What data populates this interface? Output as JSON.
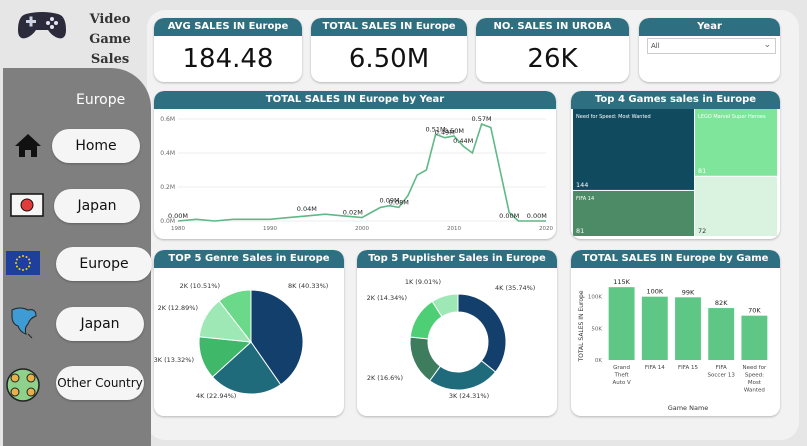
{
  "app": {
    "title_line1": "Video Game",
    "title_line2": "Sales"
  },
  "sidebar": {
    "region_title": "Europe",
    "nav": [
      {
        "label": "Home",
        "icon": "home-icon"
      },
      {
        "label": "Japan",
        "icon": "japan-flag-icon"
      },
      {
        "label": "Europe",
        "icon": "eu-flag-icon"
      },
      {
        "label": "Japan",
        "icon": "north-america-map-icon"
      },
      {
        "label": "Other Country",
        "icon": "globe-icon"
      }
    ]
  },
  "kpis": [
    {
      "title": "AVG SALES IN Europe",
      "value": "184.48"
    },
    {
      "title": "TOTAL SALES IN Europe",
      "value": "6.50M"
    },
    {
      "title": "NO. SALES IN UROBA",
      "value": "26K"
    }
  ],
  "year_filter": {
    "title": "Year",
    "selected": "All"
  },
  "line_chart": {
    "title": "TOTAL SALES IN Europe by Year",
    "y_ticks": [
      "0.0M",
      "0.2M",
      "0.4M",
      "0.6M"
    ],
    "x_ticks": [
      "1980",
      "1990",
      "2000",
      "2010",
      "2020"
    ],
    "color": "#5fb887",
    "chart_data": {
      "type": "line",
      "x": [
        1980,
        1982,
        1984,
        1986,
        1988,
        1990,
        1992,
        1994,
        1996,
        1998,
        2000,
        2001,
        2002,
        2003,
        2004,
        2005,
        2006,
        2007,
        2008,
        2009,
        2010,
        2011,
        2012,
        2013,
        2014,
        2015,
        2016,
        2017,
        2018,
        2019,
        2020
      ],
      "y": [
        0.0,
        0.01,
        0.0,
        0.01,
        0.01,
        0.01,
        0.02,
        0.03,
        0.04,
        0.03,
        0.02,
        0.05,
        0.08,
        0.09,
        0.08,
        0.15,
        0.27,
        0.3,
        0.51,
        0.49,
        0.5,
        0.44,
        0.4,
        0.57,
        0.55,
        0.3,
        0.05,
        0.0,
        0.0,
        0.0,
        0.0
      ],
      "ylim": [
        0,
        0.6
      ],
      "data_labels": [
        {
          "x": 1980,
          "y": 0.0,
          "text": "0.00M"
        },
        {
          "x": 1994,
          "y": 0.04,
          "text": "0.04M"
        },
        {
          "x": 1999,
          "y": 0.02,
          "text": "0.02M"
        },
        {
          "x": 2003,
          "y": 0.09,
          "text": "0.09M"
        },
        {
          "x": 2004,
          "y": 0.08,
          "text": "0.08M"
        },
        {
          "x": 2008,
          "y": 0.51,
          "text": "0.51M"
        },
        {
          "x": 2009,
          "y": 0.49,
          "text": "0.49M"
        },
        {
          "x": 2010,
          "y": 0.5,
          "text": "0.50M"
        },
        {
          "x": 2011,
          "y": 0.44,
          "text": "0.44M"
        },
        {
          "x": 2013,
          "y": 0.57,
          "text": "0.57M"
        },
        {
          "x": 2016,
          "y": 0.0,
          "text": "0.00M"
        },
        {
          "x": 2019,
          "y": 0.0,
          "text": "0.00M"
        }
      ]
    }
  },
  "treemap": {
    "title": "Top 4 Games sales in Europe",
    "chart_data": {
      "type": "treemap",
      "items": [
        {
          "name": "Need for Speed: Most Wanted",
          "value": 144,
          "color": "#0f4a5e"
        },
        {
          "name": "LEGO Marvel Super Heroes",
          "value": 81,
          "color": "#7fe59a"
        },
        {
          "name": "FIFA 14",
          "value": 81,
          "color": "#4d8a66"
        },
        {
          "name": "",
          "value": 72,
          "color": "#daf3e0"
        }
      ]
    }
  },
  "genre_pie": {
    "title": "TOP 5 Genre Sales in Europe",
    "chart_data": {
      "type": "pie",
      "slices": [
        {
          "label": "8K",
          "pct": "(40.33%)",
          "value": 40.33,
          "color": "#123f6b"
        },
        {
          "label": "4K",
          "pct": "(22.94%)",
          "value": 22.94,
          "color": "#1f6b7c"
        },
        {
          "label": "3K",
          "pct": "(13.32%)",
          "value": 13.32,
          "color": "#3fb86a"
        },
        {
          "label": "2K",
          "pct": "(12.89%)",
          "value": 12.89,
          "color": "#9de8b5"
        },
        {
          "label": "2K",
          "pct": "(10.51%)",
          "value": 10.51,
          "color": "#6ad98a"
        }
      ]
    }
  },
  "publisher_donut": {
    "title": "Top 5 Puplisher Sales in Europe",
    "chart_data": {
      "type": "pie",
      "slices": [
        {
          "label": "4K",
          "pct": "(35.74%)",
          "value": 35.74,
          "color": "#123f6b"
        },
        {
          "label": "3K",
          "pct": "(24.31%)",
          "value": 24.31,
          "color": "#1f6b7c"
        },
        {
          "label": "2K",
          "pct": "(16.6%)",
          "value": 16.6,
          "color": "#3d7d5d"
        },
        {
          "label": "2K",
          "pct": "(14.34%)",
          "value": 14.34,
          "color": "#4ecf75"
        },
        {
          "label": "1K",
          "pct": "(9.01%)",
          "value": 9.01,
          "color": "#9de8b5"
        }
      ]
    }
  },
  "bar_chart": {
    "title": "TOTAL SALES IN Europe by Game Name",
    "color": "#5fc785",
    "chart_data": {
      "type": "bar",
      "categories": [
        "Grand Theft Auto V",
        "FIFA 14",
        "FIFA 15",
        "FIFA Soccer 13",
        "Need for Speed: Most Wanted"
      ],
      "category_lines": [
        [
          "Grand",
          "Theft",
          "Auto V"
        ],
        [
          "FIFA 14"
        ],
        [
          "FIFA 15"
        ],
        [
          "FIFA",
          "Soccer 13"
        ],
        [
          "Need for",
          "Speed:",
          "Most",
          "Wanted"
        ]
      ],
      "values": [
        115,
        100,
        99,
        82,
        70
      ],
      "value_labels": [
        "115K",
        "100K",
        "99K",
        "82K",
        "70K"
      ],
      "y_ticks": [
        "0K",
        "50K",
        "100K"
      ],
      "ylim": [
        0,
        120
      ],
      "xlabel": "Game Name",
      "ylabel": "TOTAL SALES IN Europe"
    }
  }
}
